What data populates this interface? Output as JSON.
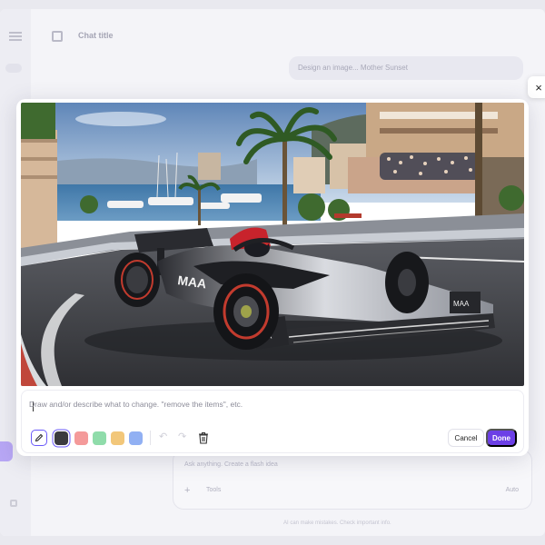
{
  "app": {
    "chat_title": "Chat title",
    "prompt_text": "Design an image... Mother Sunset",
    "composer_placeholder": "Ask anything. Create a flash idea",
    "composer_tools_label": "Tools",
    "composer_model_label": "Auto",
    "disclaimer": "AI can make mistakes. Check important info.",
    "icons": [
      "menu-icon",
      "toggle-icon",
      "new-chat-icon",
      "settings-icon",
      "plus-icon"
    ]
  },
  "editor": {
    "input_placeholder": "Draw and/or describe what to change. \"remove the items\", etc.",
    "cancel_label": "Cancel",
    "done_label": "Done",
    "close_icon": "×",
    "swatch_colors": [
      "#3b3b3f",
      "#f49a9a",
      "#8fdcaa",
      "#f2c77a",
      "#91b0f3"
    ],
    "selected_color": "#3b3b3f",
    "accent_color": "#6c3fe6",
    "tool_icons": [
      "pencil-icon",
      "undo-icon",
      "redo-icon",
      "trash-icon"
    ]
  },
  "image": {
    "subject": "Formula 1 race car on a harbor street circuit"
  }
}
